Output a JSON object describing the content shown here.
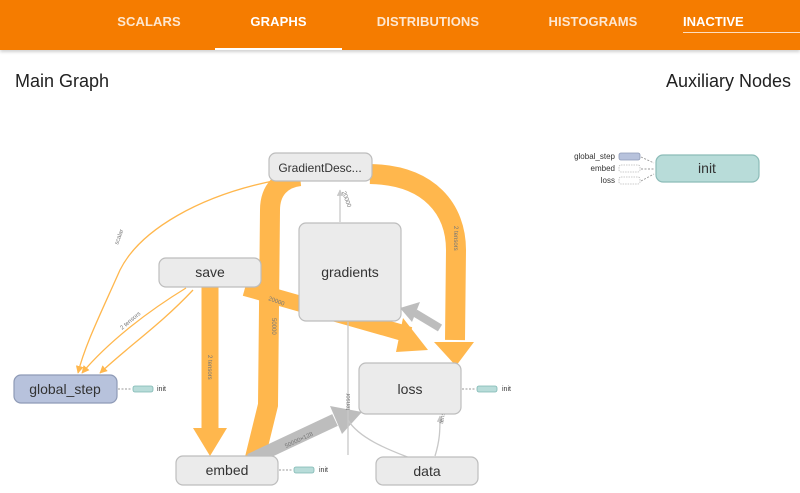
{
  "nav": {
    "tabs": [
      {
        "label": "SCALARS"
      },
      {
        "label": "GRAPHS",
        "active": true
      },
      {
        "label": "DISTRIBUTIONS"
      },
      {
        "label": "HISTOGRAMS"
      }
    ],
    "run_select": "INACTIVE"
  },
  "main_graph": {
    "title": "Main Graph",
    "nodes": {
      "gradient_descent": "GradientDesc...",
      "gradients": "gradients",
      "save": "save",
      "global_step": "global_step",
      "loss": "loss",
      "embed": "embed",
      "data": "data"
    },
    "init_ref": "init",
    "edge_labels": {
      "embed_to_gd": "50000",
      "save_to_embed": "2 tensors",
      "save_to_global": "2 tensors",
      "gd_to_global": "scalar",
      "loss_to_gd": "2 tensors",
      "embed_to_loss": "50000×128",
      "gradients_to_gd": "20000",
      "save_to_gradients": "20000",
      "data_to_loss": "tensors",
      "loss_to_gradients": "tensor"
    }
  },
  "aux_nodes": {
    "title": "Auxiliary Nodes",
    "init_label": "init",
    "inputs": [
      "global_step",
      "embed",
      "loss"
    ]
  },
  "colors": {
    "accent": "#f57c00",
    "edge_orange": "#ffb74d",
    "edge_gray": "#bdbdbd",
    "node_fill": "#ebebeb",
    "global_step_fill": "#b7c2dc",
    "init_fill": "#b8dcd9"
  }
}
